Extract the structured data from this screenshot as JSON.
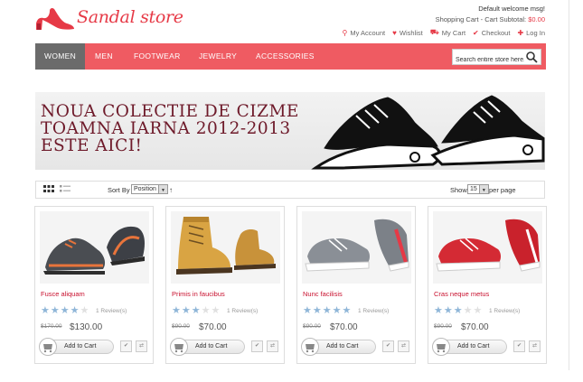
{
  "header": {
    "logo_text": "Sandal store",
    "welcome": "Default welcome msg!",
    "cart_label": "Shopping Cart - Cart Subtotal:",
    "cart_amount": "$0.00",
    "links": [
      {
        "label": "My Account",
        "icon": "user-icon"
      },
      {
        "label": "Wishlist",
        "icon": "heart-icon"
      },
      {
        "label": "My Cart",
        "icon": "cart-icon"
      },
      {
        "label": "Checkout",
        "icon": "checkout-icon"
      },
      {
        "label": "Log In",
        "icon": "login-icon"
      }
    ]
  },
  "nav": {
    "items": [
      "WOMEN",
      "MEN",
      "FOOTWEAR",
      "JEWELRY",
      "ACCESSORIES"
    ],
    "active": "WOMEN",
    "search_placeholder": "Search entire store here...",
    "accent_color": "#ef5b62"
  },
  "banner": {
    "lines": [
      "NOUA COLECTIE DE CIZME",
      "TOAMNA IARNA 2012-2013",
      "ESTE AICI!"
    ]
  },
  "toolbar": {
    "sort_label": "Sort By",
    "sort_value": "Position",
    "sort_dir": "↑",
    "show_label": "Show",
    "show_value": "15",
    "per_page": "per page"
  },
  "products": [
    {
      "name": "Fusce aliquam",
      "rating": 4,
      "reviews": "1 Review(s)",
      "old_price": "$170.00",
      "price": "$130.00",
      "cta": "Add to Cart",
      "kind": "hiker"
    },
    {
      "name": "Primis in faucibus",
      "rating": 3,
      "reviews": "1 Review(s)",
      "old_price": "$90.00",
      "price": "$70.00",
      "cta": "Add to Cart",
      "kind": "boot"
    },
    {
      "name": "Nunc facilisis",
      "rating": 5,
      "reviews": "1 Review(s)",
      "old_price": "$90.00",
      "price": "$70.00",
      "cta": "Add to Cart",
      "kind": "grey"
    },
    {
      "name": "Cras neque metus",
      "rating": 3,
      "reviews": "1 Review(s)",
      "old_price": "$90.00",
      "price": "$70.00",
      "cta": "Add to Cart",
      "kind": "red"
    }
  ]
}
